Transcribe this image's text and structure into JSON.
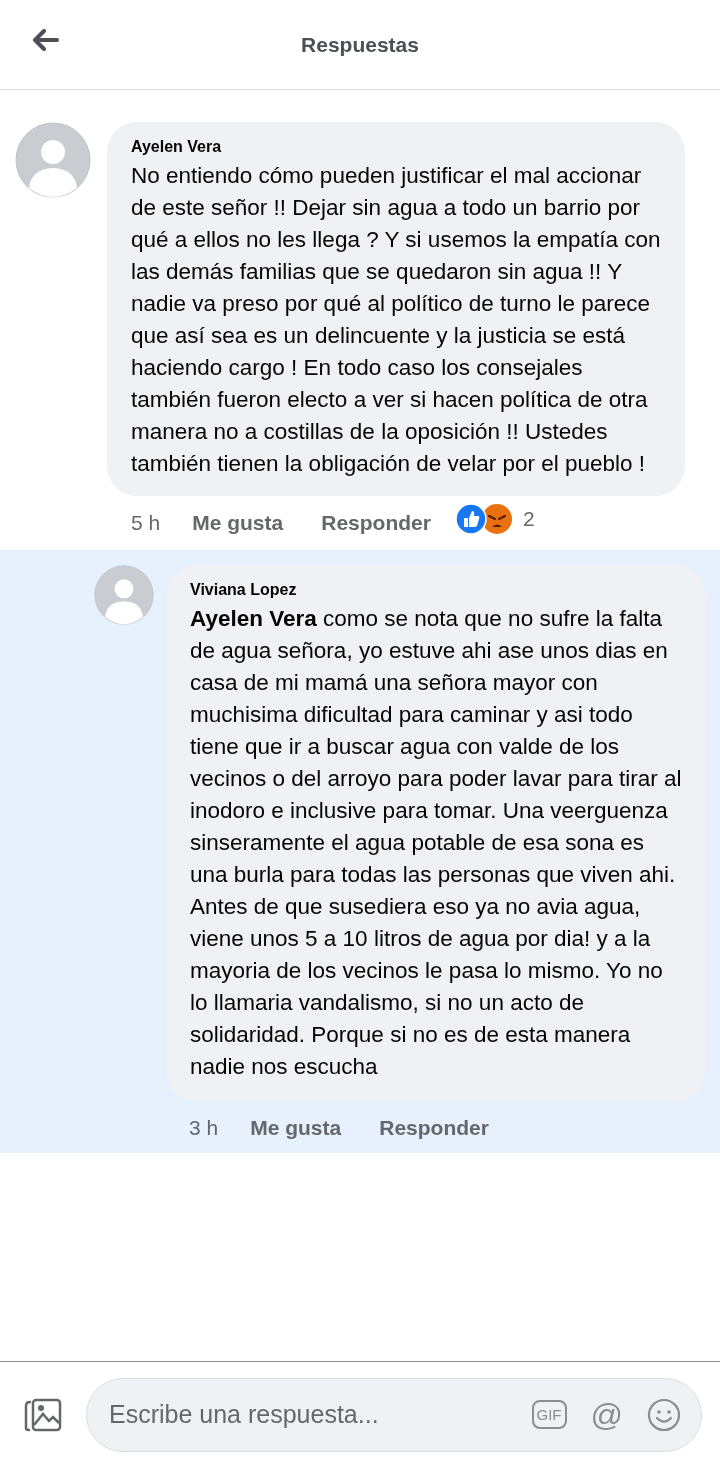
{
  "header": {
    "title": "Respuestas"
  },
  "comments": [
    {
      "author": "Ayelen Vera",
      "text": "No entiendo cómo pueden justificar el mal accionar de este señor !! Dejar sin agua a todo un barrio por qué a ellos no les llega ? Y si usemos la empatía con las demás familias que se quedaron sin agua !! Y nadie va preso por qué al político de turno le parece que así sea es un delincuente y la justicia se está haciendo cargo ! En todo caso los consejales también fueron electo a ver si hacen política de otra manera no a costillas de la oposición !! Ustedes también tienen la obligación de velar por el pueblo !",
      "time": "5 h",
      "like_label": "Me gusta",
      "reply_label": "Responder",
      "highlighted": false,
      "reply": false,
      "reactions": {
        "count": "2",
        "types": [
          {
            "kind": "like"
          },
          {
            "kind": "angry"
          }
        ]
      }
    },
    {
      "author": "Viviana Lopez",
      "text": "**Ayelen Vera** como se nota que no sufre la falta de agua señora, yo estuve ahi ase unos dias en casa de mi mamá una señora mayor con muchisima dificultad para caminar y asi todo tiene que ir a buscar agua con valde de los vecinos o del arroyo para poder  lavar para tirar al inodoro e inclusive para tomar. Una veerguenza sinseramente el agua potable de esa sona es una burla para todas las personas que viven ahi. Antes de que susediera eso ya no avia agua,  viene unos 5 a 10 litros de agua por dia! y a la mayoria de los vecinos le pasa lo mismo. Yo no lo llamaria vandalismo, si no un acto de solidaridad. Porque si no es de esta manera nadie nos escucha",
      "time": "3 h",
      "like_label": "Me gusta",
      "reply_label": "Responder",
      "highlighted": true,
      "reply": true
    }
  ],
  "composer": {
    "placeholder": "Escribe una respuesta...",
    "gif_label": "GIF",
    "mention_label": "@"
  }
}
